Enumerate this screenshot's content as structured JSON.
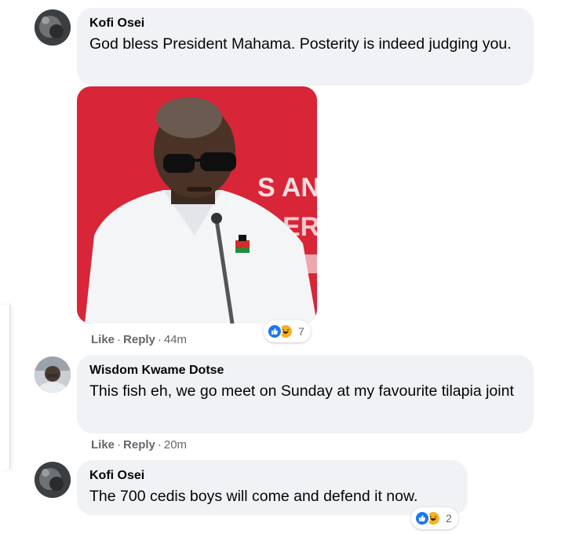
{
  "comments": [
    {
      "author": "Kofi Osei",
      "text": "God bless President Mahama. Posterity is indeed judging you.",
      "actions": {
        "like": "Like",
        "reply": "Reply",
        "sep": "·",
        "time": "44m"
      },
      "reactions": {
        "count": "7",
        "types": [
          "like-icon",
          "haha-icon"
        ]
      },
      "has_photo": true
    },
    {
      "author": "Wisdom Kwame Dotse",
      "text": "This fish eh, we go meet on Sunday at my favourite tilapia joint",
      "actions": {
        "like": "Like",
        "reply": "Reply",
        "sep": "·",
        "time": "20m"
      }
    },
    {
      "author": "Kofi Osei",
      "text": "The 700 cedis boys will come and defend it now.",
      "reactions": {
        "count": "2",
        "types": [
          "like-icon",
          "haha-icon"
        ]
      }
    }
  ],
  "colors": {
    "bubble": "#f0f2f5",
    "meta_text": "#65676b",
    "like_blue": "#1877f2",
    "haha_yellow": "#f7b125",
    "photo_red": "#e02a3b"
  }
}
